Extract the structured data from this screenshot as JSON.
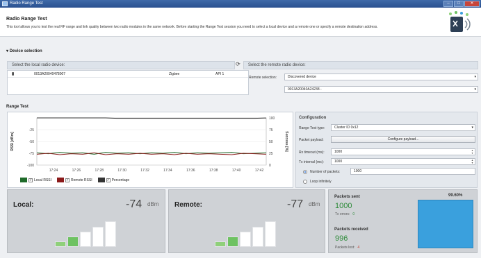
{
  "window": {
    "title": "Radio Range Test"
  },
  "header": {
    "title": "Radio Range Test",
    "description": "This tool allows you to test the real RF range and link quality between two radio modules in the same network. Before starting the Range Test session you need to select a local device and a remote one or specify a remote destination address."
  },
  "device_selection": {
    "heading": "Device selection",
    "local_label": "Select the local radio device:",
    "local_devices": [
      {
        "address": "0013A20040478007",
        "protocol": "Zigbee",
        "firmware": "API 1"
      }
    ],
    "remote_label": "Select the remote radio device:",
    "remote_selection_label": "Remote selection:",
    "remote_selection_value": "Discovered device",
    "remote_device_value": "0013A20040A24238 -"
  },
  "range_test": {
    "heading": "Range Test",
    "legend": [
      {
        "label": "Local RSSI",
        "color": "#1f6b2a",
        "checked": true
      },
      {
        "label": "Remote RSSI",
        "color": "#8b1a1a",
        "checked": true
      },
      {
        "label": "Percentage",
        "color": "#333333",
        "checked": true
      }
    ]
  },
  "chart_data": {
    "type": "line",
    "xlabel": "",
    "ylabel": "RSSI [dBm]",
    "y2label": "Success [%]",
    "x_ticks": [
      "17:24",
      "17:26",
      "17:28",
      "17:30",
      "17:32",
      "17:34",
      "17:36",
      "17:38",
      "17:40",
      "17:42"
    ],
    "y_ticks": [
      "-25",
      "-50",
      "-75",
      "-100"
    ],
    "y2_ticks": [
      "100",
      "75",
      "50",
      "25",
      "0"
    ],
    "ylim": [
      -100,
      0
    ],
    "y2lim": [
      0,
      100
    ],
    "x": [
      0,
      1,
      2,
      3,
      4,
      5,
      6,
      7,
      8,
      9,
      10,
      11,
      12,
      13,
      14,
      15,
      16,
      17,
      18,
      19,
      20
    ],
    "series": [
      {
        "name": "Local RSSI",
        "color": "#1f6b2a",
        "axis": "left",
        "values": [
          -74,
          -76,
          -73,
          -75,
          -74,
          -77,
          -73,
          -75,
          -74,
          -76,
          -74,
          -75,
          -73,
          -76,
          -74,
          -75,
          -74,
          -73,
          -76,
          -75,
          -74
        ]
      },
      {
        "name": "Remote RSSI",
        "color": "#8b1a1a",
        "axis": "left",
        "values": [
          -77,
          -75,
          -78,
          -76,
          -77,
          -74,
          -78,
          -76,
          -77,
          -75,
          -77,
          -76,
          -78,
          -75,
          -77,
          -76,
          -77,
          -78,
          -75,
          -76,
          -77
        ]
      },
      {
        "name": "Percentage",
        "color": "#333333",
        "axis": "right",
        "values": [
          100,
          100,
          100,
          100,
          100,
          100,
          100,
          99,
          99,
          99,
          99,
          99,
          99,
          99,
          99,
          99,
          99,
          99,
          99,
          99,
          99.8
        ]
      }
    ],
    "grid": true
  },
  "configuration": {
    "heading": "Configuration",
    "test_type_label": "Range Test type:",
    "test_type_value": "Cluster ID 0x12",
    "payload_label": "Packet payload:",
    "payload_button": "Configure payload...",
    "rx_timeout_label": "Rx timeout (ms):",
    "rx_timeout_value": "1000",
    "tx_interval_label": "Tx interval (ms):",
    "tx_interval_value": "1000",
    "num_packets_label": "Number of packets:",
    "num_packets_value": "1000",
    "loop_label": "Loop infinitely"
  },
  "stats": {
    "local": {
      "label": "Local:",
      "value": "-74",
      "unit": "dBm"
    },
    "remote": {
      "label": "Remote:",
      "value": "-77",
      "unit": "dBm"
    },
    "packets_sent_label": "Packets sent",
    "packets_sent": "1000",
    "tx_errors_label": "Tx errors:",
    "tx_errors": "0",
    "packets_received_label": "Packets received",
    "packets_received": "996",
    "packets_lost_label": "Packets lost:",
    "packets_lost": "4",
    "percentage": "99.60%",
    "percentage_color": "#3aa0dd"
  }
}
